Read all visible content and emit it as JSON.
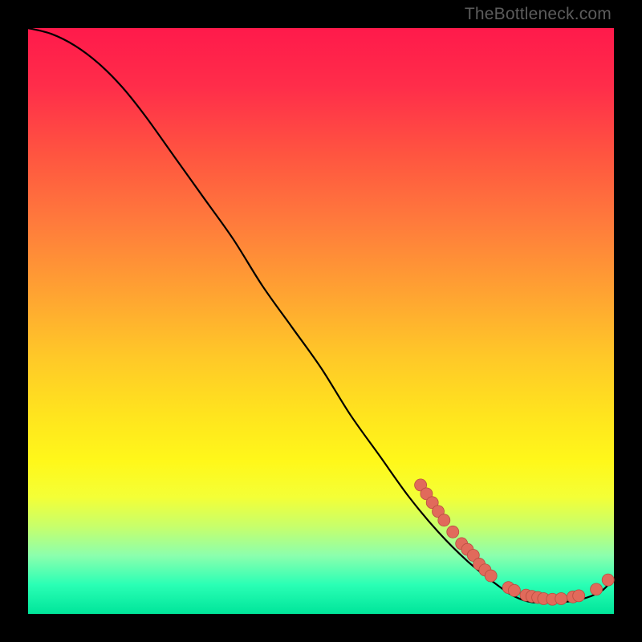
{
  "watermark": "TheBottleneck.com",
  "chart_data": {
    "type": "line",
    "title": "",
    "xlabel": "",
    "ylabel": "",
    "xlim": [
      0,
      100
    ],
    "ylim": [
      0,
      100
    ],
    "grid": false,
    "series": [
      {
        "name": "bottleneck-curve",
        "points": [
          {
            "x": 0,
            "y": 100
          },
          {
            "x": 4,
            "y": 99
          },
          {
            "x": 8,
            "y": 97
          },
          {
            "x": 12,
            "y": 94
          },
          {
            "x": 16,
            "y": 90
          },
          {
            "x": 20,
            "y": 85
          },
          {
            "x": 25,
            "y": 78
          },
          {
            "x": 30,
            "y": 71
          },
          {
            "x": 35,
            "y": 64
          },
          {
            "x": 40,
            "y": 56
          },
          {
            "x": 45,
            "y": 49
          },
          {
            "x": 50,
            "y": 42
          },
          {
            "x": 55,
            "y": 34
          },
          {
            "x": 60,
            "y": 27
          },
          {
            "x": 65,
            "y": 20
          },
          {
            "x": 70,
            "y": 14
          },
          {
            "x": 75,
            "y": 9
          },
          {
            "x": 80,
            "y": 5
          },
          {
            "x": 83,
            "y": 3
          },
          {
            "x": 86,
            "y": 2
          },
          {
            "x": 90,
            "y": 2
          },
          {
            "x": 93,
            "y": 2.2
          },
          {
            "x": 96,
            "y": 3
          },
          {
            "x": 98,
            "y": 4
          },
          {
            "x": 100,
            "y": 6
          }
        ]
      }
    ],
    "scatter_points": [
      {
        "x": 67,
        "y": 22
      },
      {
        "x": 68,
        "y": 20.5
      },
      {
        "x": 69,
        "y": 19
      },
      {
        "x": 70,
        "y": 17.5
      },
      {
        "x": 71,
        "y": 16
      },
      {
        "x": 72.5,
        "y": 14
      },
      {
        "x": 74,
        "y": 12
      },
      {
        "x": 75,
        "y": 11
      },
      {
        "x": 76,
        "y": 10
      },
      {
        "x": 77,
        "y": 8.5
      },
      {
        "x": 78,
        "y": 7.5
      },
      {
        "x": 79,
        "y": 6.5
      },
      {
        "x": 82,
        "y": 4.5
      },
      {
        "x": 83,
        "y": 4
      },
      {
        "x": 85,
        "y": 3.2
      },
      {
        "x": 86,
        "y": 3
      },
      {
        "x": 87,
        "y": 2.8
      },
      {
        "x": 88,
        "y": 2.6
      },
      {
        "x": 89.5,
        "y": 2.5
      },
      {
        "x": 91,
        "y": 2.6
      },
      {
        "x": 93,
        "y": 2.9
      },
      {
        "x": 94,
        "y": 3.1
      },
      {
        "x": 97,
        "y": 4.2
      },
      {
        "x": 99,
        "y": 5.8
      }
    ]
  }
}
